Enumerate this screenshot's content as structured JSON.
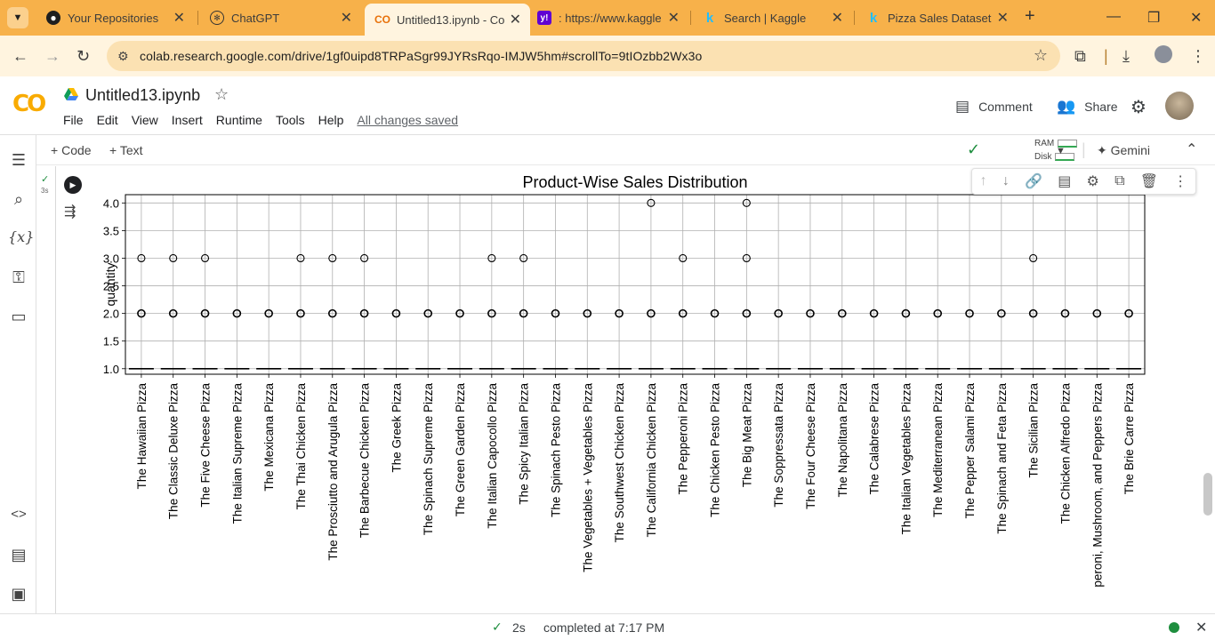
{
  "browser": {
    "tabs": [
      {
        "label": "Your Repositories",
        "icon": "github-icon"
      },
      {
        "label": "ChatGPT",
        "icon": "chatgpt-icon"
      },
      {
        "label": "Untitled13.ipynb - Co",
        "icon": "colab-icon",
        "active": true
      },
      {
        "label": ": https://www.kaggle",
        "icon": "yahoo-icon"
      },
      {
        "label": "Search | Kaggle",
        "icon": "kaggle-icon"
      },
      {
        "label": "Pizza Sales Dataset",
        "icon": "kaggle-icon"
      }
    ],
    "url": "colab.research.google.com/drive/1gf0uipd8TRPaSgr99JYRsRqo-IMJW5hm#scrollTo=9tIOzbb2Wx3o"
  },
  "colab": {
    "notebook_title": "Untitled13.ipynb",
    "menu": [
      "File",
      "Edit",
      "View",
      "Insert",
      "Runtime",
      "Tools",
      "Help"
    ],
    "save_status": "All changes saved",
    "comment_label": "Comment",
    "share_label": "Share",
    "add_code_label": "Code",
    "add_text_label": "Text",
    "ram_label": "RAM",
    "disk_label": "Disk",
    "gemini_label": "Gemini",
    "cell_exec_time": "3s"
  },
  "status": {
    "elapsed": "2s",
    "message": "completed at 7:17 PM"
  },
  "chart_data": {
    "type": "box",
    "title": "Product-Wise Sales Distribution",
    "xlabel": "",
    "ylabel": "quantity",
    "ylim": [
      0.9,
      4.15
    ],
    "yticks": [
      "1.0",
      "1.5",
      "2.0",
      "2.5",
      "3.0",
      "3.5",
      "4.0"
    ],
    "grid": true,
    "categories": [
      {
        "name": "The Hawaiian Pizza",
        "outliers": [
          2,
          3
        ]
      },
      {
        "name": "The Classic Deluxe Pizza",
        "outliers": [
          2,
          3
        ]
      },
      {
        "name": "The Five Cheese Pizza",
        "outliers": [
          2,
          3
        ]
      },
      {
        "name": "The Italian Supreme Pizza",
        "outliers": [
          2
        ]
      },
      {
        "name": "The Mexicana Pizza",
        "outliers": [
          2
        ]
      },
      {
        "name": "The Thai Chicken Pizza",
        "outliers": [
          2,
          3
        ]
      },
      {
        "name": "The Prosciutto and Arugula Pizza",
        "outliers": [
          2,
          3
        ]
      },
      {
        "name": "The Barbecue Chicken Pizza",
        "outliers": [
          2,
          3
        ]
      },
      {
        "name": "The Greek Pizza",
        "outliers": [
          2
        ]
      },
      {
        "name": "The Spinach Supreme Pizza",
        "outliers": [
          2
        ]
      },
      {
        "name": "The Green Garden Pizza",
        "outliers": [
          2
        ]
      },
      {
        "name": "The Italian Capocollo Pizza",
        "outliers": [
          2,
          3
        ]
      },
      {
        "name": "The Spicy Italian Pizza",
        "outliers": [
          2,
          3
        ]
      },
      {
        "name": "The Spinach Pesto Pizza",
        "outliers": [
          2
        ]
      },
      {
        "name": "The Vegetables + Vegetables Pizza",
        "outliers": [
          2
        ]
      },
      {
        "name": "The Southwest Chicken Pizza",
        "outliers": [
          2
        ]
      },
      {
        "name": "The California Chicken Pizza",
        "outliers": [
          2,
          4
        ]
      },
      {
        "name": "The Pepperoni Pizza",
        "outliers": [
          2,
          3
        ]
      },
      {
        "name": "The Chicken Pesto Pizza",
        "outliers": [
          2
        ]
      },
      {
        "name": "The Big Meat Pizza",
        "outliers": [
          2,
          3,
          4
        ]
      },
      {
        "name": "The Soppressata Pizza",
        "outliers": [
          2
        ]
      },
      {
        "name": "The Four Cheese Pizza",
        "outliers": [
          2
        ]
      },
      {
        "name": "The Napolitana Pizza",
        "outliers": [
          2
        ]
      },
      {
        "name": "The Calabrese Pizza",
        "outliers": [
          2
        ]
      },
      {
        "name": "The Italian Vegetables Pizza",
        "outliers": [
          2
        ]
      },
      {
        "name": "The Mediterranean Pizza",
        "outliers": [
          2
        ]
      },
      {
        "name": "The Pepper Salami Pizza",
        "outliers": [
          2
        ]
      },
      {
        "name": "The Spinach and Feta Pizza",
        "outliers": [
          2
        ]
      },
      {
        "name": "The Sicilian Pizza",
        "outliers": [
          2,
          3
        ]
      },
      {
        "name": "The Chicken Alfredo Pizza",
        "outliers": [
          2
        ]
      },
      {
        "name": "peroni, Mushroom, and Peppers Pizza",
        "outliers": [
          2
        ]
      },
      {
        "name": "The Brie Carre Pizza",
        "outliers": [
          2
        ]
      }
    ],
    "median": 1,
    "q1": 1,
    "q3": 1
  }
}
